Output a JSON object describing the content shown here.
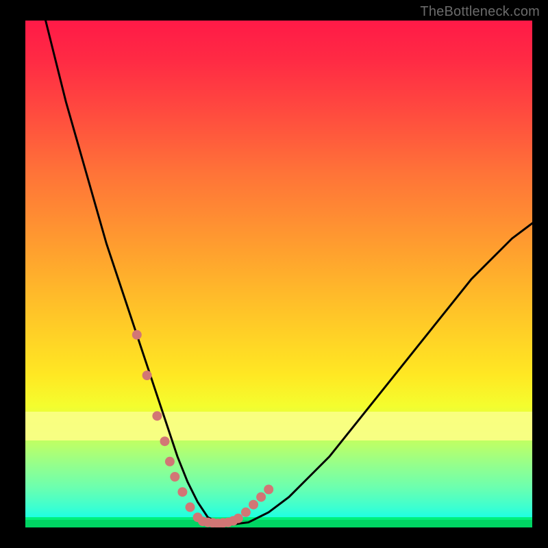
{
  "watermark": "TheBottleneck.com",
  "colors": {
    "black": "#000000",
    "curve": "#000000",
    "dots": "#d27675",
    "band": "#fbff86",
    "green1": "#00f07c",
    "green2": "#00d463"
  },
  "chart_data": {
    "type": "line",
    "title": "",
    "xlabel": "",
    "ylabel": "",
    "xlim": [
      0,
      100
    ],
    "ylim": [
      0,
      100
    ],
    "series": [
      {
        "name": "bottleneck-curve",
        "x": [
          4,
          6,
          8,
          10,
          12,
          14,
          16,
          18,
          20,
          22,
          24,
          26,
          28,
          30,
          32,
          34,
          36,
          38,
          40,
          44,
          48,
          52,
          56,
          60,
          64,
          68,
          72,
          76,
          80,
          84,
          88,
          92,
          96,
          100
        ],
        "y": [
          100,
          92,
          84,
          77,
          70,
          63,
          56,
          50,
          44,
          38,
          32,
          26,
          20,
          14,
          9,
          5,
          2,
          1,
          0.5,
          1,
          3,
          6,
          10,
          14,
          19,
          24,
          29,
          34,
          39,
          44,
          49,
          53,
          57,
          60
        ]
      }
    ],
    "markers": {
      "name": "highlight-dots",
      "x": [
        22,
        24,
        26,
        27.5,
        28.5,
        29.5,
        31,
        32.5,
        34,
        35,
        36,
        37,
        38,
        39,
        40,
        41,
        42,
        43.5,
        45,
        46.5,
        48
      ],
      "y": [
        38,
        30,
        22,
        17,
        13,
        10,
        7,
        4,
        2,
        1.2,
        1,
        0.9,
        0.8,
        0.9,
        1,
        1.3,
        1.8,
        3,
        4.5,
        6,
        7.5
      ]
    },
    "band": {
      "y_from": 18,
      "y_to": 24,
      "note": "bright-yellow-band"
    },
    "legend": []
  }
}
